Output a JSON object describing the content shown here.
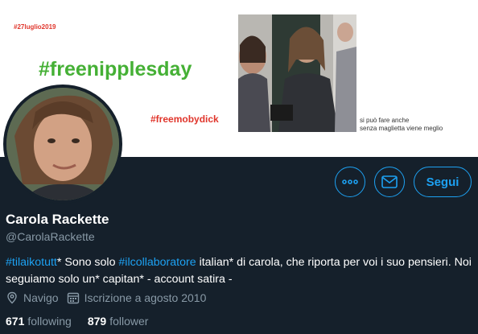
{
  "banner": {
    "date_tag": "#27luglio2019",
    "main_tag": "#freenipplesday",
    "moby_tag": "#freemobydick",
    "caption_line1": "si può fare anche",
    "caption_line2": "senza maglietta viene meglio"
  },
  "actions": {
    "follow_label": "Segui"
  },
  "profile": {
    "name": "Carola Rackette",
    "handle": "@CarolaRackette",
    "bio": {
      "tag1": "#tilaikotutt",
      "text1": "* Sono solo ",
      "tag2": "#ilcollaboratore",
      "text2": " italian* di carola, che riporta per voi i suo pensieri. Noi seguiamo solo un* capitan* - account satira -"
    },
    "location": "Navigo",
    "joined": "Iscrizione a agosto 2010",
    "following_count": "671",
    "following_label": "following",
    "follower_count": "879",
    "follower_label": "follower"
  },
  "colors": {
    "background": "#15202b",
    "accent": "#1da1f2",
    "secondary_text": "#8899a6",
    "banner_green": "#45b035",
    "banner_red": "#e0352b"
  },
  "icons": {
    "more": "more-icon",
    "message": "envelope-icon",
    "location": "location-pin-icon",
    "calendar": "calendar-icon"
  }
}
